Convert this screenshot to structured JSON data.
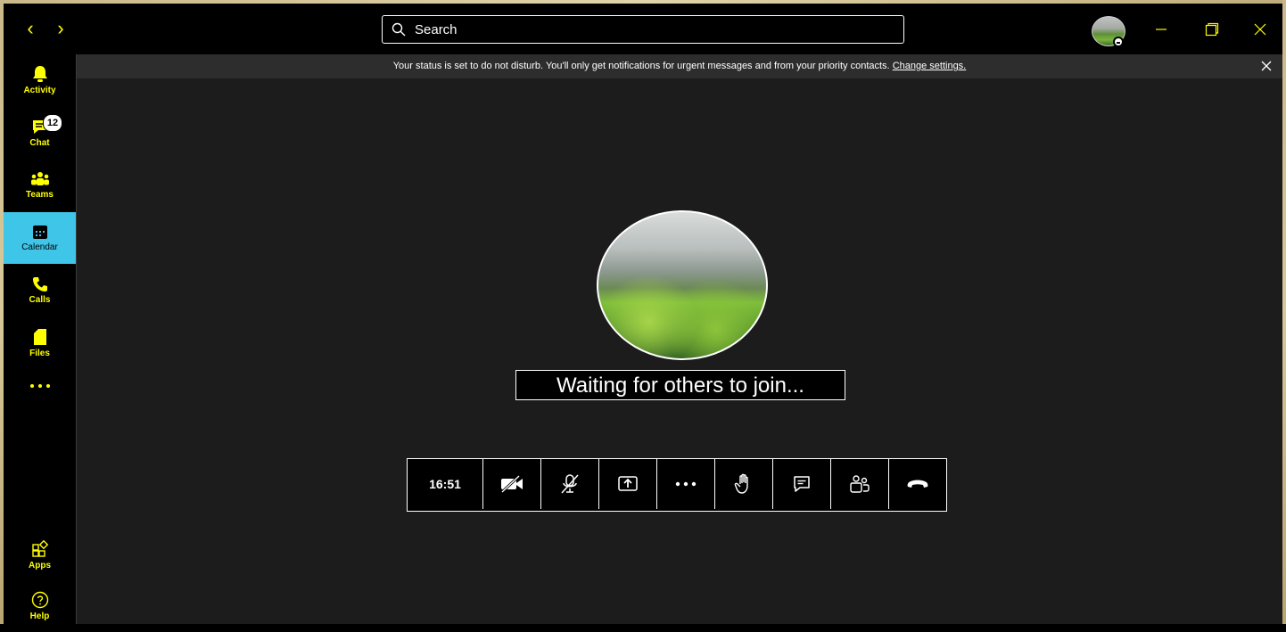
{
  "search": {
    "placeholder": "Search"
  },
  "sidebar": {
    "items": [
      {
        "label": "Activity"
      },
      {
        "label": "Chat",
        "badge": "12"
      },
      {
        "label": "Teams"
      },
      {
        "label": "Calendar"
      },
      {
        "label": "Calls"
      },
      {
        "label": "Files"
      },
      {
        "label": "Apps"
      },
      {
        "label": "Help"
      }
    ]
  },
  "banner": {
    "text": "Your status is set to do not disturb. You'll only get notifications for urgent messages and from your priority contacts.",
    "link": "Change settings."
  },
  "meeting": {
    "status": "Waiting for others to join...",
    "timer": "16:51"
  },
  "colors": {
    "accent": "#ffff00",
    "active": "#3ec5e8",
    "background": "#1c1c1c"
  }
}
